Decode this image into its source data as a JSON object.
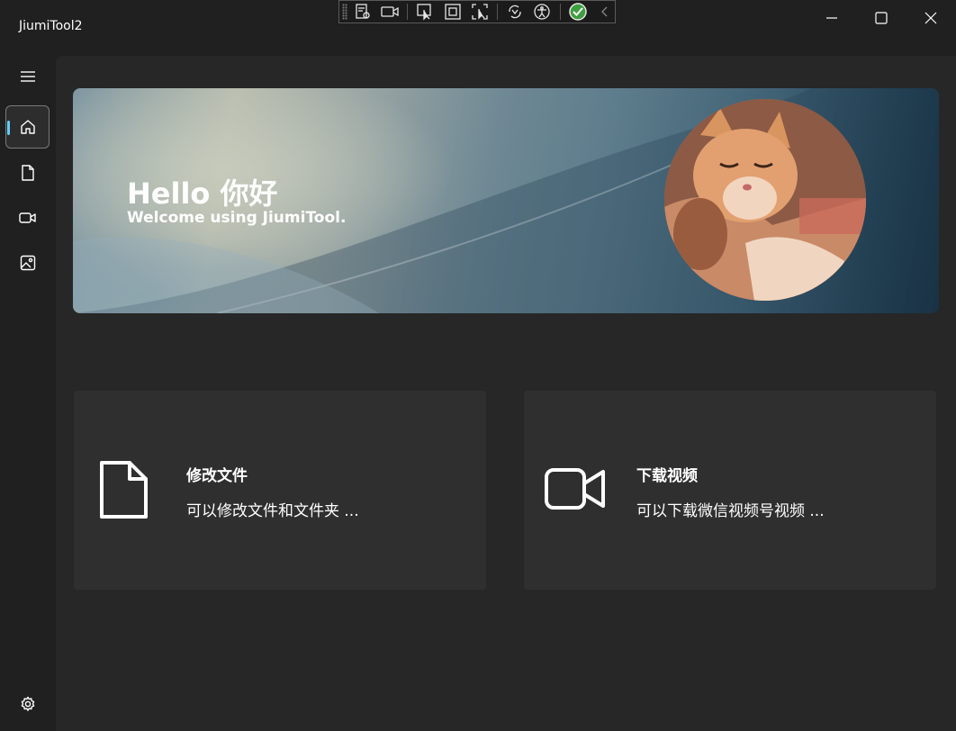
{
  "window": {
    "title": "JiumiTool2"
  },
  "hero": {
    "title": "Hello 你好",
    "subtitle": "Welcome using JiumiTool."
  },
  "cards": [
    {
      "title": "修改文件",
      "description": "可以修改文件和文件夹 ...",
      "icon": "document-icon"
    },
    {
      "title": "下载视频",
      "description": "可以下载微信视频号视频 ...",
      "icon": "video-camera-icon"
    }
  ],
  "nav": {
    "items": [
      {
        "icon": "home-icon",
        "selected": true
      },
      {
        "icon": "document-icon",
        "selected": false
      },
      {
        "icon": "video-icon",
        "selected": false
      },
      {
        "icon": "image-icon",
        "selected": false
      }
    ],
    "footer_icon": "settings-gear-icon"
  },
  "colors": {
    "background": "#202020",
    "content": "#272727",
    "card": "#2f2f2f",
    "accent": "#60cdff"
  }
}
